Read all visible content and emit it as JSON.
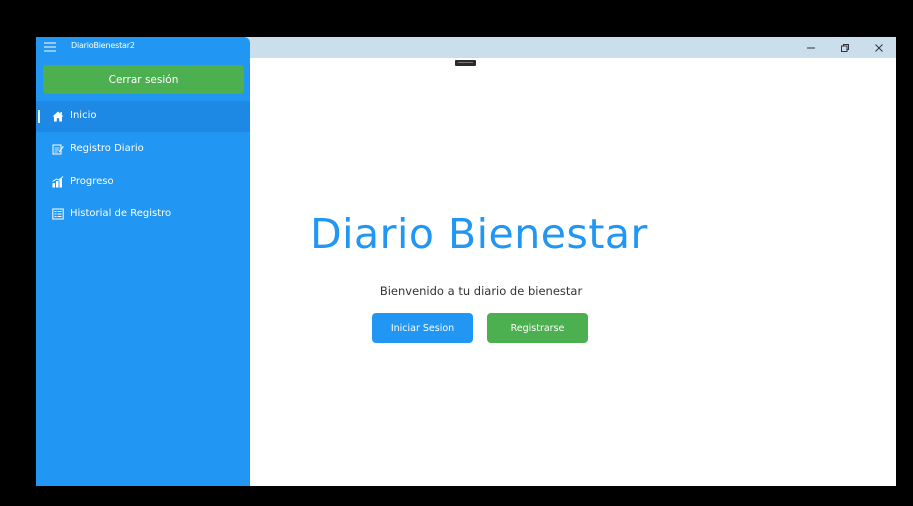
{
  "window": {
    "app_title": "DiarioBienestar2",
    "controls": {
      "minimize_icon": "minimize-icon",
      "restore_icon": "restore-icon",
      "close_icon": "close-icon"
    }
  },
  "sidebar": {
    "logout_label": "Cerrar sesión",
    "items": [
      {
        "label": "Inicio",
        "icon": "home-icon",
        "active": true
      },
      {
        "label": "Registro Diario",
        "icon": "edit-document-icon",
        "active": false
      },
      {
        "label": "Progreso",
        "icon": "bar-chart-icon",
        "active": false
      },
      {
        "label": "Historial de Registro",
        "icon": "history-list-icon",
        "active": false
      }
    ]
  },
  "main": {
    "title": "Diario Bienestar",
    "welcome": "Bienvenido  a tu diario de bienestar",
    "login_label": "Iniciar Sesion",
    "register_label": "Registrarse"
  },
  "colors": {
    "primary": "#2196f3",
    "success": "#4caf50",
    "titlebar": "#cbdeec",
    "active_item": "#1e88e5"
  }
}
